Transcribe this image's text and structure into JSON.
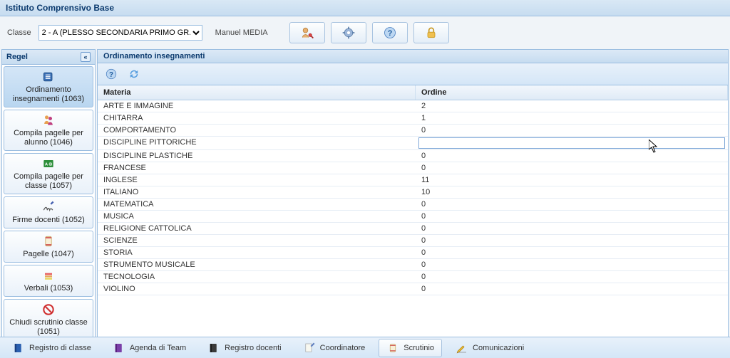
{
  "app_title": "Istituto Comprensivo Base",
  "topbar": {
    "class_label": "Classe",
    "class_selected": "2 - A (PLESSO SECONDARIA PRIMO GR.)",
    "user_name": "Manuel MEDIA"
  },
  "sidebar": {
    "title": "Regel",
    "items": [
      {
        "label": "Ordinamento insegnamenti (1063)",
        "icon": "ordering-icon"
      },
      {
        "label": "Compila pagelle per alunno (1046)",
        "icon": "student-doc-icon"
      },
      {
        "label": "Compila pagelle per classe (1057)",
        "icon": "abc-board-icon"
      },
      {
        "label": "Firme docenti (1052)",
        "icon": "signature-icon"
      },
      {
        "label": "Pagelle (1047)",
        "icon": "scroll-icon"
      },
      {
        "label": "Verbali (1053)",
        "icon": "stack-doc-icon"
      },
      {
        "label": "Chiudi scrutinio classe (1051)",
        "icon": "forbidden-icon"
      }
    ]
  },
  "main": {
    "title": "Ordinamento insegnamenti",
    "columns": {
      "materia": "Materia",
      "ordine": "Ordine"
    },
    "rows": [
      {
        "materia": "ARTE E IMMAGINE",
        "ordine": "2"
      },
      {
        "materia": "CHITARRA",
        "ordine": "1"
      },
      {
        "materia": "COMPORTAMENTO",
        "ordine": "0"
      },
      {
        "materia": "DISCIPLINE PITTORICHE",
        "ordine": "",
        "editing": true
      },
      {
        "materia": "DISCIPLINE PLASTICHE",
        "ordine": "0"
      },
      {
        "materia": "FRANCESE",
        "ordine": "0"
      },
      {
        "materia": "INGLESE",
        "ordine": "11"
      },
      {
        "materia": "ITALIANO",
        "ordine": "10"
      },
      {
        "materia": "MATEMATICA",
        "ordine": "0"
      },
      {
        "materia": "MUSICA",
        "ordine": "0"
      },
      {
        "materia": "RELIGIONE CATTOLICA",
        "ordine": "0"
      },
      {
        "materia": "SCIENZE",
        "ordine": "0"
      },
      {
        "materia": "STORIA",
        "ordine": "0"
      },
      {
        "materia": "STRUMENTO MUSICALE",
        "ordine": "0"
      },
      {
        "materia": "TECNOLOGIA",
        "ordine": "0"
      },
      {
        "materia": "VIOLINO",
        "ordine": "0"
      }
    ]
  },
  "bottombar": {
    "items": [
      {
        "label": "Registro di classe",
        "icon": "book-blue-icon"
      },
      {
        "label": "Agenda di Team",
        "icon": "book-purple-icon"
      },
      {
        "label": "Registro docenti",
        "icon": "book-black-icon"
      },
      {
        "label": "Coordinatore",
        "icon": "pen-doc-icon"
      },
      {
        "label": "Scrutinio",
        "icon": "scroll-small-icon",
        "active": true
      },
      {
        "label": "Comunicazioni",
        "icon": "pencil-write-icon"
      }
    ]
  }
}
